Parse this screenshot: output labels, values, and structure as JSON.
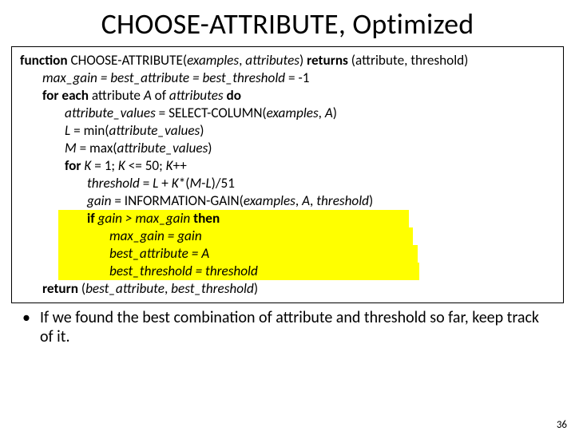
{
  "title": "CHOOSE-ATTRIBUTE, Optimized",
  "c": {
    "l1a": "function",
    "l1b": " CHOOSE-ATTRIBUTE(",
    "l1c": "examples",
    "l1c2": ", ",
    "l1d": "attributes",
    "l1e": ") ",
    "l1f": "returns",
    "l1g": " (attribute, threshold)",
    "l2": "max_gain = best_attribute = best_threshold",
    "l2b": " = -1",
    "l3a": "for each ",
    "l3b": "attribute ",
    "l3c": "A",
    "l3d": " of ",
    "l3e": "attributes",
    "l3f": " do",
    "l4a": "attribute_values",
    "l4b": " = SELECT-COLUMN(",
    "l4c": "examples",
    "l4d": ", ",
    "l4e": "A",
    "l4f": ")",
    "l5a": "L",
    "l5b": " = min(",
    "l5c": "attribute_values",
    "l5d": ")",
    "l6a": "M",
    "l6b": " = max(",
    "l6c": "attribute_values",
    "l6d": ")",
    "l7a": "for ",
    "l7b": "K",
    "l7c": " = 1; ",
    "l7d": "K",
    "l7e": " <= 50; ",
    "l7f": "K",
    "l7g": "++",
    "l8a": "threshold",
    "l8b": " = ",
    "l8c": "L",
    "l8d": " + ",
    "l8e": "K",
    "l8f": "*(",
    "l8g": "M",
    "l8h": "-",
    "l8i": "L",
    "l8j": ")/51",
    "l9a": "gain",
    "l9b": " = INFORMATION-GAIN(",
    "l9c": "examples",
    "l9d": ", ",
    "l9e": "A",
    "l9f": ", ",
    "l9g": "threshold",
    "l9h": ")",
    "l10a": "if",
    "l10b": " gain > max_gain ",
    "l10c": "then",
    "l11": "max_gain = gain",
    "l12": "best_attribute = A",
    "l13": "best_threshold = threshold",
    "l14a": "return",
    "l14b": " (",
    "l14c": "best_attribute",
    "l14d": ", ",
    "l14e": "best_threshold",
    "l14f": ")"
  },
  "bullet": "If we found the best combination of attribute and threshold so far, keep track of it.",
  "page": "36"
}
